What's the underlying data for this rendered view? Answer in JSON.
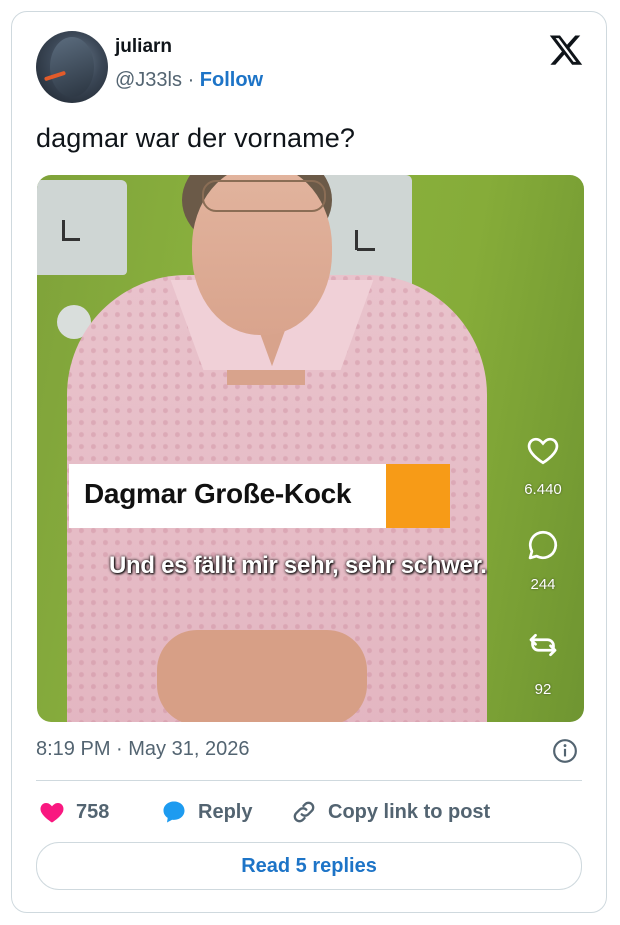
{
  "user": {
    "display_name": "juliarn",
    "handle": "@J33ls",
    "separator": "·",
    "follow_label": "Follow"
  },
  "tweet": {
    "text": "dagmar war der vorname?",
    "timestamp": "8:19 PM · May 31, 2026"
  },
  "video": {
    "name_caption": "Dagmar Große-Kock",
    "subtitle": "Und es fällt mir sehr, sehr schwer.",
    "likes": "6.440",
    "comments": "244",
    "shares": "92"
  },
  "actions": {
    "like_count": "758",
    "reply_label": "Reply",
    "copy_link_label": "Copy link to post"
  },
  "read_replies_label": "Read 5 replies",
  "colors": {
    "follow_blue": "#1d74c7",
    "like_pink": "#f91880",
    "reply_blue": "#1d9bf0",
    "caption_orange": "#f79b17"
  }
}
